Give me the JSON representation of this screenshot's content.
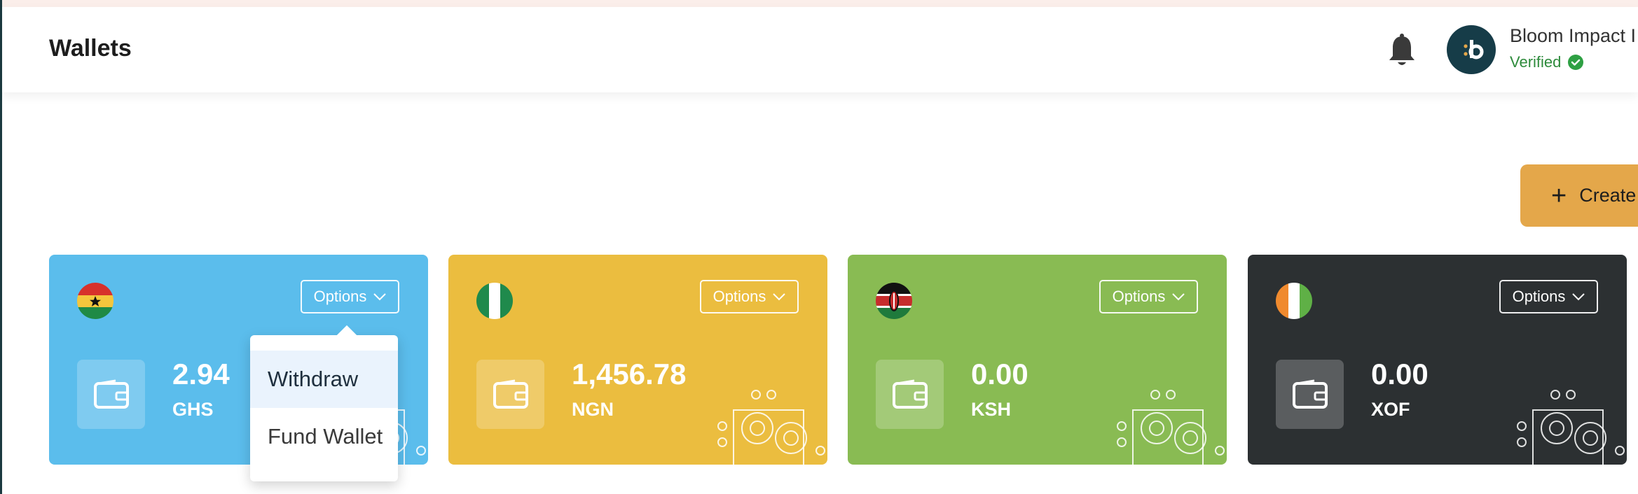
{
  "header": {
    "title": "Wallets",
    "org_name": "Bloom Impact I",
    "verified_label": "Verified"
  },
  "actions": {
    "create_label": "Create"
  },
  "wallets": [
    {
      "flag": "ghana-flag",
      "options_label": "Options",
      "amount": "2.94",
      "currency": "GHS",
      "color": "#5bbdec"
    },
    {
      "flag": "nigeria-flag",
      "options_label": "Options",
      "amount": "1,456.78",
      "currency": "NGN",
      "color": "#ebbd3f"
    },
    {
      "flag": "kenya-flag",
      "options_label": "Options",
      "amount": "0.00",
      "currency": "KSH",
      "color": "#89bb53"
    },
    {
      "flag": "ivory-coast-flag",
      "options_label": "Options",
      "amount": "0.00",
      "currency": "XOF",
      "color": "#2c3032"
    }
  ],
  "dropdown": {
    "items": [
      "Withdraw",
      "Fund Wallet"
    ],
    "highlighted": "Withdraw"
  },
  "colors": {
    "header_bg": "#ffffff",
    "create_button": "#e4a74a",
    "verified": "#2e8b3c",
    "avatar_bg": "#163c48"
  }
}
